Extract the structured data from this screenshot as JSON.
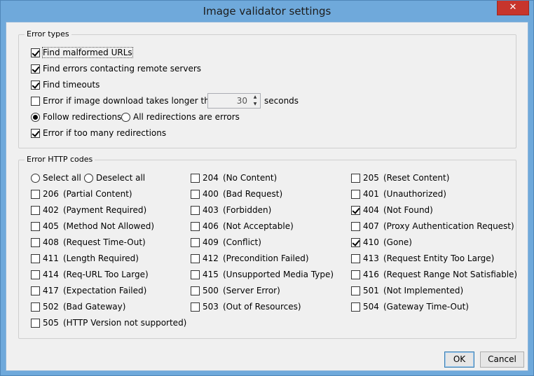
{
  "window": {
    "title": "Image validator settings",
    "close_glyph": "✕"
  },
  "error_types": {
    "legend": "Error types",
    "malformed": {
      "label": "Find malformed URLs",
      "checked": true
    },
    "remote": {
      "label": "Find errors contacting remote servers",
      "checked": true
    },
    "timeouts": {
      "label": "Find timeouts",
      "checked": true
    },
    "download": {
      "label": "Error if image download takes longer than",
      "checked": false,
      "value": "30",
      "suffix": "seconds"
    },
    "follow": {
      "label": "Follow redirections",
      "selected": true
    },
    "all_redirects": {
      "label": "All redirections are errors",
      "selected": false
    },
    "too_many": {
      "label": "Error if too many redirections",
      "checked": true
    }
  },
  "http": {
    "legend": "Error HTTP codes",
    "select_all": "Select all",
    "deselect_all": "Deselect all",
    "codes": [
      {
        "code": "204",
        "desc": "(No Content)",
        "checked": false
      },
      {
        "code": "205",
        "desc": "(Reset Content)",
        "checked": false
      },
      {
        "code": "206",
        "desc": "(Partial Content)",
        "checked": false
      },
      {
        "code": "400",
        "desc": "(Bad Request)",
        "checked": false
      },
      {
        "code": "401",
        "desc": "(Unauthorized)",
        "checked": false
      },
      {
        "code": "402",
        "desc": "(Payment Required)",
        "checked": false
      },
      {
        "code": "403",
        "desc": "(Forbidden)",
        "checked": false
      },
      {
        "code": "404",
        "desc": "(Not Found)",
        "checked": true
      },
      {
        "code": "405",
        "desc": "(Method Not Allowed)",
        "checked": false
      },
      {
        "code": "406",
        "desc": "(Not Acceptable)",
        "checked": false
      },
      {
        "code": "407",
        "desc": "(Proxy Authentication Request)",
        "checked": false
      },
      {
        "code": "408",
        "desc": "(Request Time-Out)",
        "checked": false
      },
      {
        "code": "409",
        "desc": "(Conflict)",
        "checked": false
      },
      {
        "code": "410",
        "desc": "(Gone)",
        "checked": true
      },
      {
        "code": "411",
        "desc": "(Length Required)",
        "checked": false
      },
      {
        "code": "412",
        "desc": "(Precondition Failed)",
        "checked": false
      },
      {
        "code": "413",
        "desc": "(Request Entity Too Large)",
        "checked": false
      },
      {
        "code": "414",
        "desc": "(Req-URL Too Large)",
        "checked": false
      },
      {
        "code": "415",
        "desc": "(Unsupported Media Type)",
        "checked": false
      },
      {
        "code": "416",
        "desc": "(Request Range Not Satisfiable)",
        "checked": false
      },
      {
        "code": "417",
        "desc": "(Expectation Failed)",
        "checked": false
      },
      {
        "code": "500",
        "desc": "(Server Error)",
        "checked": false
      },
      {
        "code": "501",
        "desc": "(Not Implemented)",
        "checked": false
      },
      {
        "code": "502",
        "desc": "(Bad Gateway)",
        "checked": false
      },
      {
        "code": "503",
        "desc": "(Out of Resources)",
        "checked": false
      },
      {
        "code": "504",
        "desc": "(Gateway Time-Out)",
        "checked": false
      },
      {
        "code": "505",
        "desc": "(HTTP Version not supported)",
        "checked": false
      }
    ]
  },
  "buttons": {
    "ok": "OK",
    "cancel": "Cancel"
  }
}
